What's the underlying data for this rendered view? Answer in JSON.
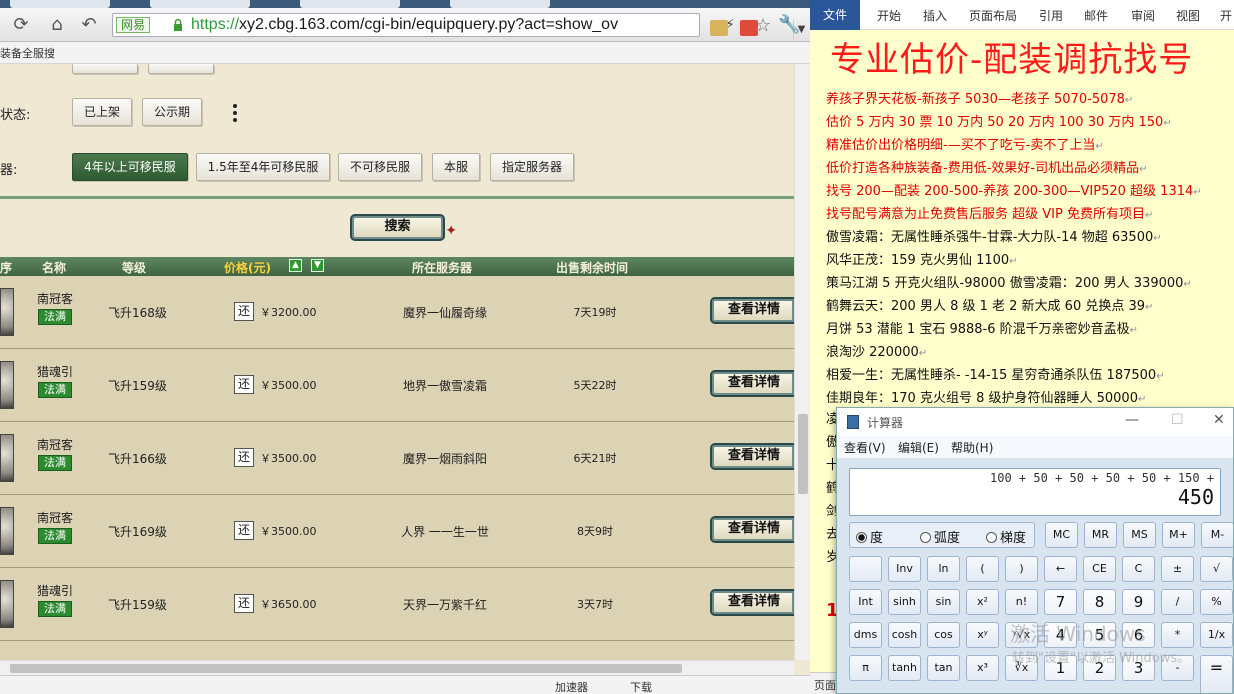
{
  "browser": {
    "url_scheme": "https://",
    "url_rest": "xy2.cbg.163.com/cgi-bin/equipquery.py?act=show_ov",
    "cert_label": "网易",
    "bookmark": "装备全服搜",
    "status_bar": {
      "accelerator": "加速器",
      "download": "下载"
    }
  },
  "filters": {
    "status_label": "状态:",
    "status_buttons": [
      "已上架",
      "公示期"
    ],
    "server_label": "器:",
    "server_buttons": [
      "4年以上可移民服",
      "1.5年至4年可移民服",
      "不可移民服",
      "本服",
      "指定服务器"
    ],
    "search_label": "搜索"
  },
  "table": {
    "headers": {
      "index": "序",
      "name": "名称",
      "level": "等级",
      "price": "价格(元)",
      "server": "所在服务器",
      "time": "出售剩余时间"
    },
    "return_label": "还",
    "detail_label": "查看详情",
    "rows": [
      {
        "name": "南冠客",
        "badge": "法满",
        "level": "飞升168级",
        "price": "￥3200.00",
        "server": "魔界一仙履奇缘",
        "time": "7天19时"
      },
      {
        "name": "猎魂引",
        "badge": "法满",
        "level": "飞升159级",
        "price": "￥3500.00",
        "server": "地界一傲雪凌霜",
        "time": "5天22时"
      },
      {
        "name": "南冠客",
        "badge": "法满",
        "level": "飞升166级",
        "price": "￥3500.00",
        "server": "魔界一烟雨斜阳",
        "time": "6天21时"
      },
      {
        "name": "南冠客",
        "badge": "法满",
        "level": "飞升169级",
        "price": "￥3500.00",
        "server": "人界 一一生一世",
        "time": "8天9时"
      },
      {
        "name": "猎魂引",
        "badge": "法满",
        "level": "飞升159级",
        "price": "￥3650.00",
        "server": "天界一万紫千红",
        "time": "3天7时"
      }
    ]
  },
  "word": {
    "tabs": [
      "文件",
      "开始",
      "插入",
      "页面布局",
      "引用",
      "邮件",
      "审阅",
      "视图",
      "开"
    ],
    "heading": "专业估价-配装调抗找号",
    "status_left": "页面",
    "lines": [
      {
        "text": "养孩子界天花板-新孩子 5030—老孩子 5070-5078",
        "color": "red"
      },
      {
        "text": "估价 5 万内 30 票   10 万内 50  20 万内 100  30 万内 150",
        "color": "red"
      },
      {
        "text": "精准估价出价格明细-—买不了吃亏-卖不了上当",
        "color": "red"
      },
      {
        "text": "低价打造各种族装备-费用低-效果好-司机出品必须精品",
        "color": "red"
      },
      {
        "text": "找号 200—配装 200-500-养孩 200-300—VIP520 超级 1314",
        "color": "red"
      },
      {
        "text": "找号配号满意为止免费售后服务    超级 VIP 免费所有项目",
        "color": "red"
      },
      {
        "text": "傲雪凌霜：无属性睡杀强牛-甘霖-大力队-14 物超 63500",
        "color": "black"
      },
      {
        "text": "风华正茂：159 克火男仙 1100",
        "color": "black"
      },
      {
        "text": "策马江湖 5 开克火组队-98000 傲雪凌霜：200 男人 339000",
        "color": "black"
      },
      {
        "text": "鹤舞云天：200 男人 8 级 1 老 2 新大成 60 兑换点 39",
        "color": "black"
      },
      {
        "text": "月饼 53 潜能 1 宝石 9888-6 阶混千万亲密妙音孟极",
        "color": "black"
      },
      {
        "text": "浪淘沙 220000",
        "color": "black"
      },
      {
        "text": "相爱一生：无属性睡杀-  -14-15 星穷奇通杀队伍 187500",
        "color": "black"
      },
      {
        "text": "佳期良年：170 克火组号 8 级护身符仙器睡人 50000",
        "color": "black"
      }
    ],
    "partial_lines": [
      "凌",
      "傲",
      "十",
      "鹤",
      "剑",
      "去",
      "岁",
      "1"
    ]
  },
  "calculator": {
    "title": "计算器",
    "menu": [
      "查看(V)",
      "编辑(E)",
      "帮助(H)"
    ],
    "expression": "100 + 50 + 50 + 50 + 50 + 150 +",
    "value": "450",
    "angle_modes": [
      "度",
      "弧度",
      "梯度"
    ],
    "rows": [
      [
        "MC",
        "MR",
        "MS",
        "M+",
        "M-"
      ],
      [
        "",
        "Inv",
        "ln",
        "(",
        ")",
        "←",
        "CE",
        "C",
        "±",
        "√"
      ],
      [
        "Int",
        "sinh",
        "sin",
        "x²",
        "n!",
        "7",
        "8",
        "9",
        "/",
        "%"
      ],
      [
        "dms",
        "cosh",
        "cos",
        "xʸ",
        "ʸ√x",
        "4",
        "5",
        "6",
        "*",
        "1/x"
      ],
      [
        "π",
        "tanh",
        "tan",
        "x³",
        "∛x",
        "1",
        "2",
        "3",
        "-",
        "="
      ]
    ]
  },
  "watermark": {
    "line1": "激活 Windows",
    "line2": "转到\"设置\"以激活 Windows。"
  },
  "colors": {
    "accent_green": "#3e6441",
    "price_header": "#ffcf3d",
    "word_red": "#ff1a1a",
    "word_file_tab": "#2b579a"
  }
}
